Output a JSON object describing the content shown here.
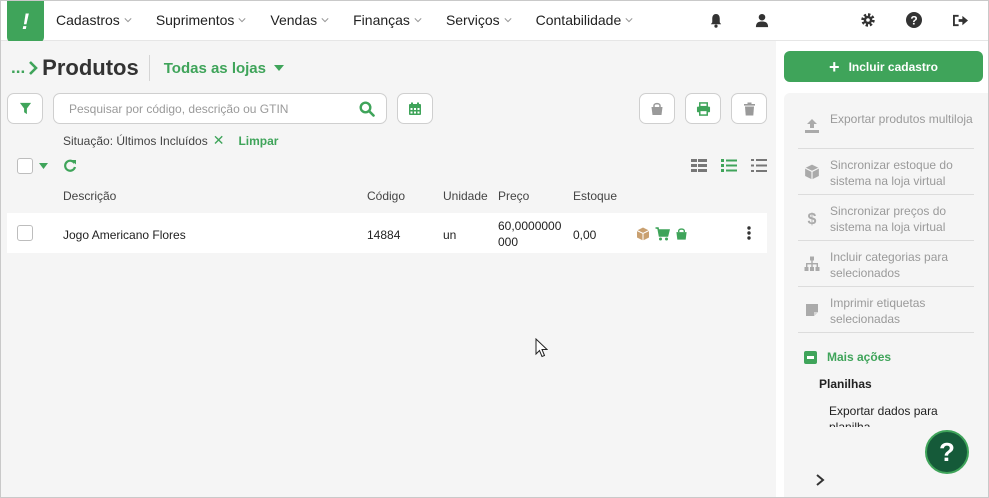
{
  "brand": {
    "logo_glyph": "!",
    "color": "#3fa45a"
  },
  "menu": [
    {
      "label": "Cadastros"
    },
    {
      "label": "Suprimentos"
    },
    {
      "label": "Vendas"
    },
    {
      "label": "Finanças"
    },
    {
      "label": "Serviços"
    },
    {
      "label": "Contabilidade"
    }
  ],
  "header": {
    "breadcrumb_prefix": "...",
    "title": "Produtos",
    "store_filter": "Todas as lojas"
  },
  "search": {
    "placeholder": "Pesquisar por código, descrição ou GTIN",
    "value": ""
  },
  "filter": {
    "label": "Situação: Últimos Incluídos",
    "remove": "✕",
    "clear": "Limpar"
  },
  "table": {
    "columns": [
      "Descrição",
      "Código",
      "Unidade",
      "Preço",
      "Estoque"
    ],
    "rows": [
      {
        "descricao": "Jogo Americano Flores",
        "codigo": "14884",
        "unidade": "un",
        "preco_line1": "60,0000000",
        "preco_line2": "000",
        "estoque": "0,00"
      }
    ]
  },
  "sidebar": {
    "include_button": "Incluir cadastro",
    "actions": [
      {
        "label": "Exportar produtos multiloja",
        "icon": "upload-icon"
      },
      {
        "label": "Sincronizar estoque do sistema na loja virtual",
        "icon": "box-icon"
      },
      {
        "label": "Sincronizar preços do sistema na loja virtual",
        "icon": "dollar-icon"
      },
      {
        "label": "Incluir categorias para selecionados",
        "icon": "sitemap-icon"
      },
      {
        "label": "Imprimir etiquetas selecionadas",
        "icon": "label-icon"
      }
    ],
    "more_actions": "Mais ações",
    "sheets_title": "Planilhas",
    "export_data": "Exportar dados para planilha",
    "help": "?"
  }
}
